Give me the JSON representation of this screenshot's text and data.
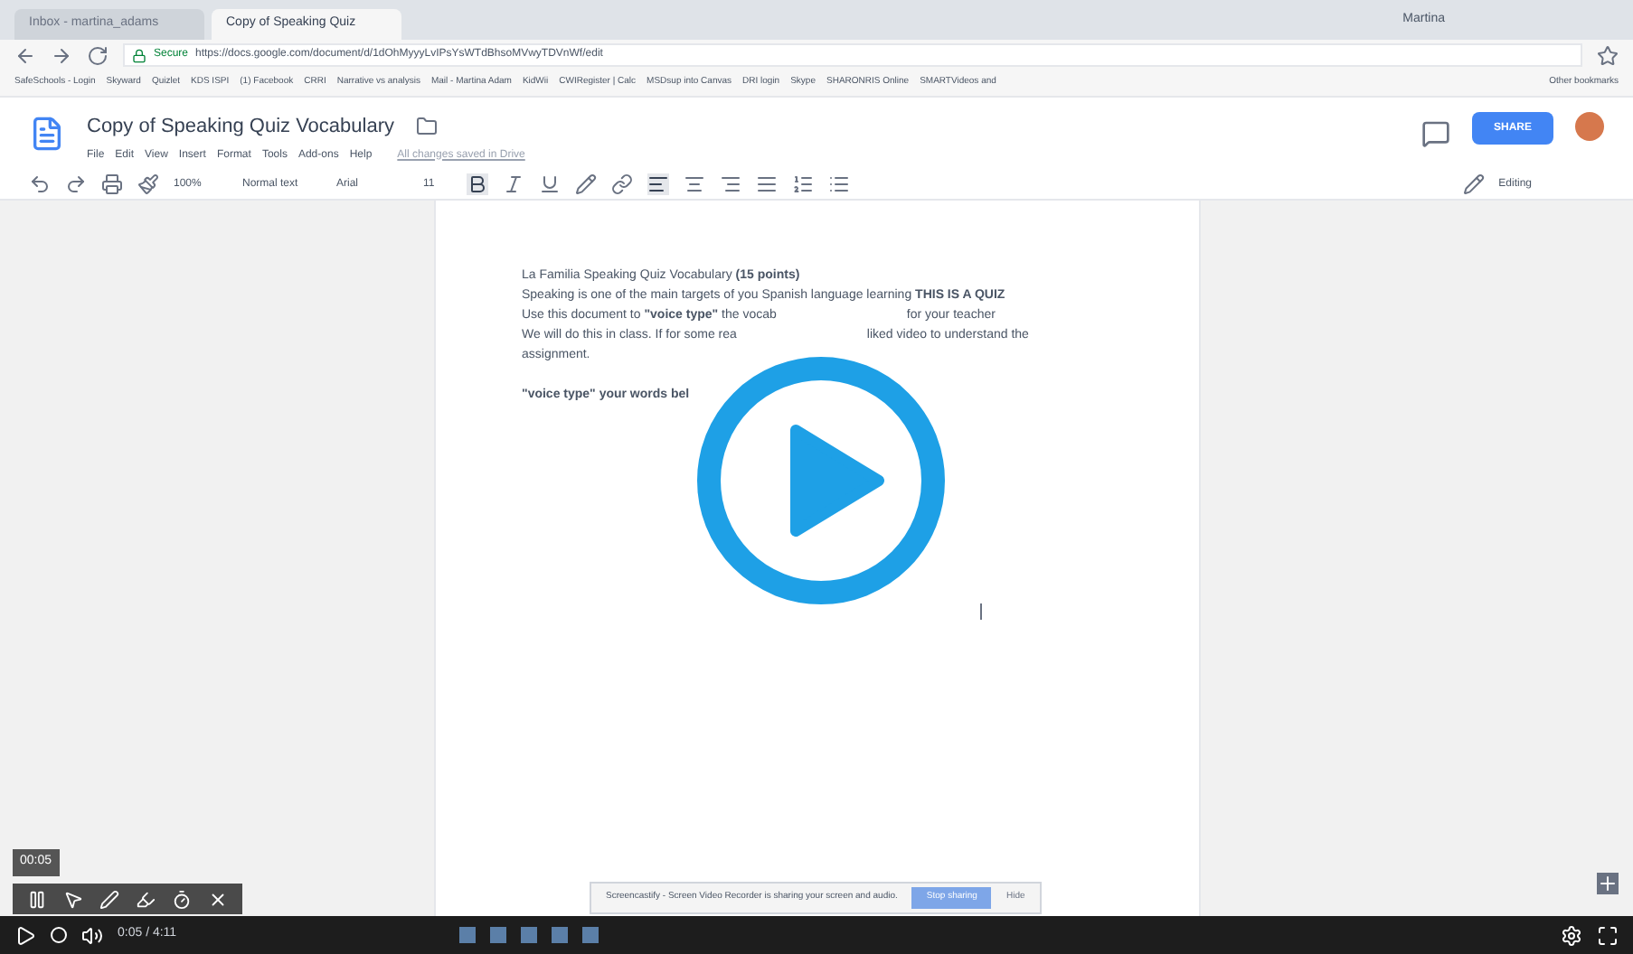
{
  "browser": {
    "tabs": [
      {
        "label": "Inbox - martina_adams",
        "selected": false
      },
      {
        "label": "Copy of Speaking Quiz",
        "selected": true
      }
    ],
    "user": "Martina",
    "secure_label": "Secure",
    "url": "https://docs.google.com/document/d/1dOhMyyyLvIPsYsWTdBhsoMVwyTDVnWf/edit",
    "bookmarks": [
      "SafeSchools - Login",
      "Skyward",
      "Quizlet",
      "KDS ISPI",
      "(1) Facebook",
      "CRRI",
      "Narrative vs analysis",
      "Mail - Martina Adam",
      "KidWii",
      "CWIRegister | Calc",
      "MSDsup into Canvas",
      "DRI login",
      "Skype",
      "SHARONRIS Online",
      "SMARTVideos and"
    ],
    "other_bookmarks": "Other bookmarks"
  },
  "docs": {
    "title": "Copy of Speaking Quiz Vocabulary",
    "menus": [
      "File",
      "Edit",
      "View",
      "Insert",
      "Format",
      "Tools",
      "Add-ons",
      "Help"
    ],
    "save_status": "All changes saved in Drive",
    "share": "SHARE",
    "toolbar": {
      "zoom": "100%",
      "style": "Normal text",
      "font": "Arial",
      "size": "11",
      "mode": "Editing"
    }
  },
  "document": {
    "lines": [
      {
        "kind": "text",
        "text": "La Familia Speaking Quiz Vocabulary **(15 points)**",
        "bold": false
      },
      {
        "kind": "text",
        "text": "Speaking is one of the main targets of you Spanish language learning **THIS IS A QUIZ**",
        "bold": false
      },
      {
        "kind": "split",
        "left": "Use this document to **\"voice type\"** the vocab",
        "right": "for your teacher"
      },
      {
        "kind": "split",
        "left": "We will do this in class. If for some rea",
        "right": "liked video to understand the"
      },
      {
        "kind": "text",
        "text": "assignment.",
        "bold": false
      },
      {
        "kind": "blank"
      },
      {
        "kind": "text",
        "text": "\"voice type\" your words bel",
        "bold": true
      }
    ]
  },
  "recorder": {
    "time": "00:05",
    "banner": "Screencastify - Screen Video Recorder is sharing your screen and audio.",
    "stop": "Stop sharing",
    "hide": "Hide"
  },
  "player": {
    "time": "0:05 / 4:11"
  }
}
